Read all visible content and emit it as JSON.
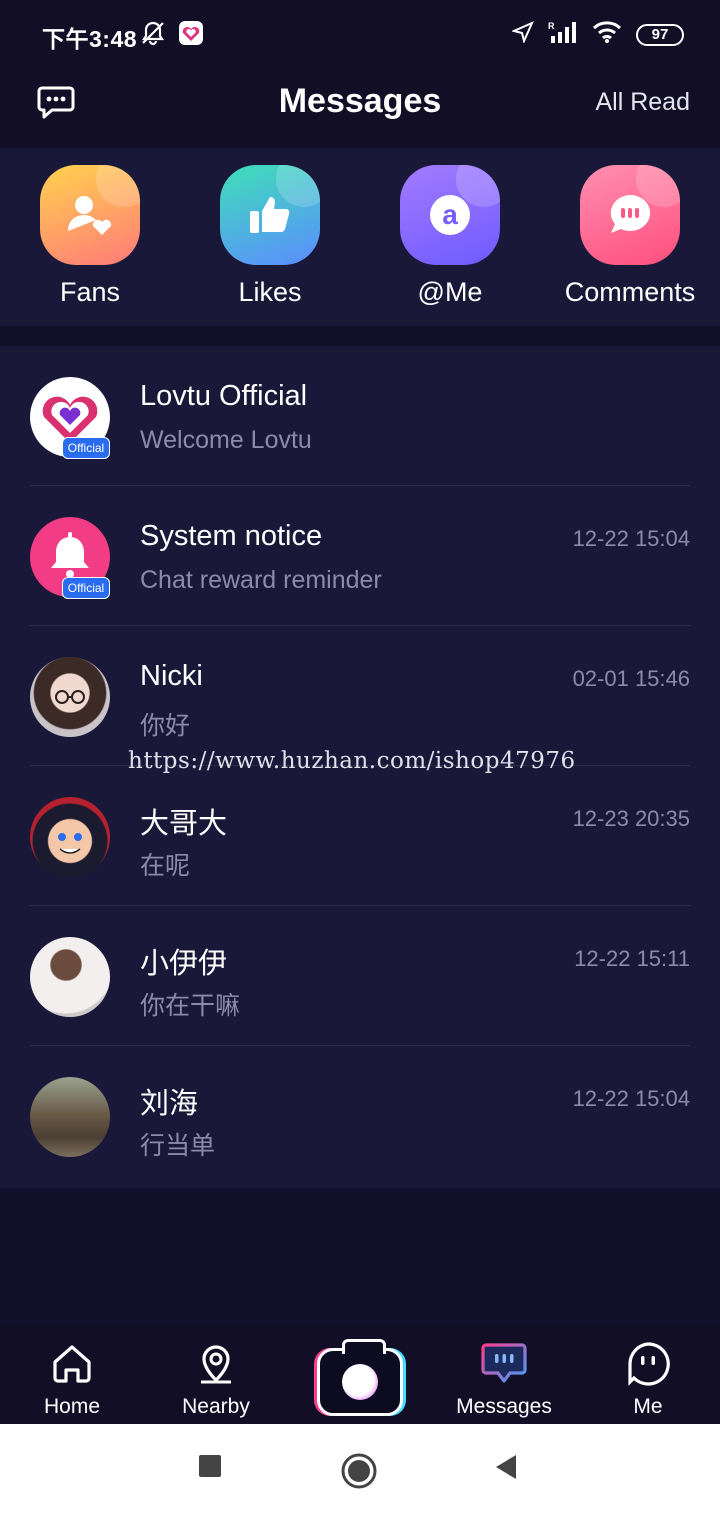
{
  "status": {
    "time": "下午3:48",
    "battery": "97",
    "icons": [
      "bell-off-icon",
      "app-heart-icon",
      "location-icon",
      "signal-icon",
      "wifi-icon",
      "battery-icon"
    ]
  },
  "header": {
    "title": "Messages",
    "right_action": "All Read",
    "left_icon": "chat-bubble-icon"
  },
  "quick": [
    {
      "label": "Fans",
      "icon": "fans-icon",
      "color_from": "#ffd24d",
      "color_to": "#ff7a7a"
    },
    {
      "label": "Likes",
      "icon": "thumbs-up-icon",
      "color_from": "#3fe0b8",
      "color_to": "#5b8cff"
    },
    {
      "label": "@Me",
      "icon": "at-icon",
      "color_from": "#a37bff",
      "color_to": "#6f5bff"
    },
    {
      "label": "Comments",
      "icon": "comment-icon",
      "color_from": "#ff8fb0",
      "color_to": "#ff4f7d"
    }
  ],
  "messages": [
    {
      "name": "Lovtu Official",
      "text": "Welcome Lovtu",
      "time": "",
      "badge": "Official",
      "avatar": "lovtu-logo-avatar"
    },
    {
      "name": "System notice",
      "text": "Chat reward reminder",
      "time": "12-22 15:04",
      "badge": "Official",
      "avatar": "bell-avatar"
    },
    {
      "name": "Nicki",
      "text": "你好",
      "time": "02-01 15:46",
      "badge": "",
      "avatar": "user-avatar"
    },
    {
      "name": "大哥大",
      "text": "在呢",
      "time": "12-23 20:35",
      "badge": "",
      "avatar": "user-avatar"
    },
    {
      "name": "小伊伊",
      "text": "你在干嘛",
      "time": "12-22 15:11",
      "badge": "",
      "avatar": "user-avatar"
    },
    {
      "name": "刘海",
      "text": "行当单",
      "time": "12-22 15:04",
      "badge": "",
      "avatar": "user-avatar"
    }
  ],
  "watermark": "https://www.huzhan.com/ishop47976",
  "nav": [
    {
      "label": "Home",
      "icon": "home-icon"
    },
    {
      "label": "Nearby",
      "icon": "location-pin-icon"
    },
    {
      "label": "",
      "icon": "camera-icon"
    },
    {
      "label": "Messages",
      "icon": "messages-icon"
    },
    {
      "label": "Me",
      "icon": "me-face-icon"
    }
  ],
  "colors": {
    "background": "#120f2a",
    "panel": "#1a1838",
    "muted_text": "#8d8aa8",
    "badge_blue": "#2a6cf0",
    "accent_pink": "#ff3d8d"
  }
}
